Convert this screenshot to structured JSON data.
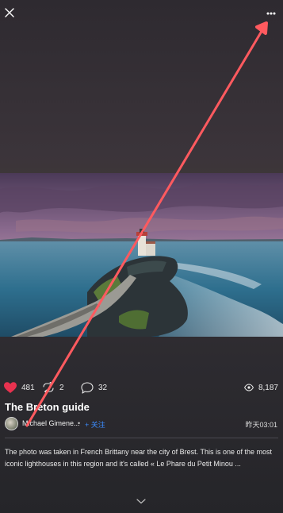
{
  "post": {
    "title": "The Breton guide",
    "author": "Michael Gimene...",
    "separator": "•",
    "follow_label": "+ 关注",
    "timestamp": "昨天03:01",
    "description": "The photo was taken in French Brittany near the city of Brest. This is one of the most iconic lighthouses in this region and it's called « Le Phare du Petit Minou ..."
  },
  "stats": {
    "likes": "481",
    "reposts": "2",
    "comments": "32",
    "views": "8,187"
  },
  "icons": {
    "close": "close-icon",
    "more": "more-dots-icon",
    "like": "heart-icon",
    "repost": "repost-icon",
    "comment": "comment-bubble-icon",
    "views": "eye-icon",
    "expand": "chevron-down-icon"
  },
  "colors": {
    "like": "#e8324f",
    "follow": "#3c8cff",
    "arrow": "#ff5a5f"
  }
}
